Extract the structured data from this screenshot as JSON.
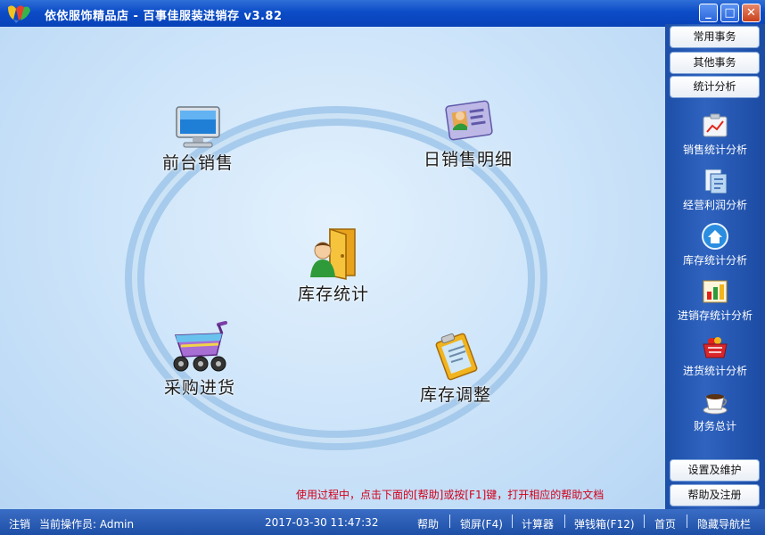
{
  "window": {
    "title": "依依服饰精品店 - 百事佳服装进销存 v3.82",
    "minimize": "_",
    "maximize": "□",
    "close": "✕"
  },
  "main": {
    "tiles": {
      "front_sales": "前台销售",
      "daily_sales_detail": "日销售明细",
      "inventory_stats": "库存统计",
      "purchasing": "采购进货",
      "inventory_adjust": "库存调整"
    },
    "help_hint": "使用过程中，点击下面的[帮助]或按[F1]键，打开相应的帮助文档"
  },
  "sidebar": {
    "top_buttons": [
      "常用事务",
      "其他事务",
      "统计分析"
    ],
    "items": [
      {
        "label": "销售统计分析",
        "icon": "sales-chart-icon"
      },
      {
        "label": "经营利润分析",
        "icon": "profit-doc-icon"
      },
      {
        "label": "库存统计分析",
        "icon": "home-icon"
      },
      {
        "label": "进销存统计分析",
        "icon": "bar-chart-icon"
      },
      {
        "label": "进货统计分析",
        "icon": "basket-icon"
      },
      {
        "label": "财务总计",
        "icon": "coffee-cup-icon"
      }
    ],
    "bottom_buttons": [
      "设置及维护",
      "帮助及注册"
    ]
  },
  "statusbar": {
    "logout": "注销",
    "operator": "当前操作员: Admin",
    "datetime": "2017-03-30 11:47:32",
    "help": "帮助",
    "lock": "锁屏(F4)",
    "calculator": "计算器",
    "cash_drawer": "弹钱箱(F12)",
    "home": "首页",
    "hide_nav": "隐藏导航栏"
  }
}
